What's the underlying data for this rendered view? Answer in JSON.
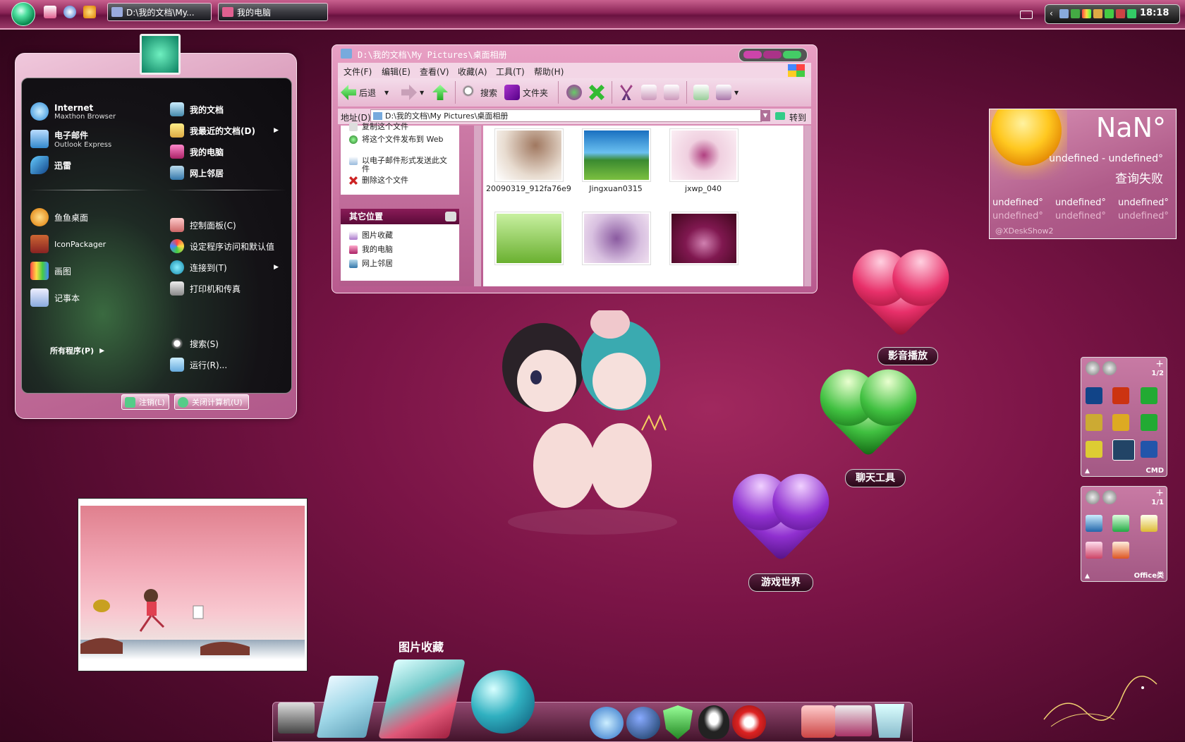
{
  "taskbar": {
    "tasks": [
      {
        "label": "D:\\我的文档\\My..."
      },
      {
        "label": "我的电脑"
      }
    ],
    "clock": "18:18"
  },
  "start_menu": {
    "pinned": [
      {
        "title": "Internet",
        "subtitle": "Maxthon Browser",
        "icon": "maxthon-browser-icon"
      },
      {
        "title": "电子邮件",
        "subtitle": "Outlook Express",
        "icon": "outlook-express-icon"
      },
      {
        "title": "迅雷",
        "subtitle": "",
        "icon": "xunlei-icon"
      }
    ],
    "recent": [
      {
        "title": "鱼鱼桌面",
        "icon": "fish-desktop-icon"
      },
      {
        "title": "IconPackager",
        "icon": "iconpackager-icon"
      },
      {
        "title": "画图",
        "icon": "paint-icon"
      },
      {
        "title": "记事本",
        "icon": "notepad-icon"
      }
    ],
    "all_programs": "所有程序(P)",
    "right_items": [
      {
        "title": "我的文档",
        "bold": true,
        "arrow": false,
        "icon": "my-documents-icon"
      },
      {
        "title": "我最近的文档(D)",
        "bold": true,
        "arrow": true,
        "icon": "recent-documents-icon"
      },
      {
        "title": "我的电脑",
        "bold": true,
        "arrow": false,
        "icon": "my-computer-icon"
      },
      {
        "title": "网上邻居",
        "bold": true,
        "arrow": false,
        "icon": "network-places-icon"
      },
      {
        "title": "控制面板(C)",
        "bold": false,
        "arrow": false,
        "icon": "control-panel-icon"
      },
      {
        "title": "设定程序访问和默认值",
        "bold": false,
        "arrow": false,
        "icon": "program-defaults-icon"
      },
      {
        "title": "连接到(T)",
        "bold": false,
        "arrow": true,
        "icon": "connect-to-icon"
      },
      {
        "title": "打印机和传真",
        "bold": false,
        "arrow": false,
        "icon": "printer-icon"
      },
      {
        "title": "搜索(S)",
        "bold": false,
        "arrow": false,
        "icon": "search-icon"
      },
      {
        "title": "运行(R)...",
        "bold": false,
        "arrow": false,
        "icon": "run-icon"
      }
    ],
    "logoff": "注销(L)",
    "shutdown": "关闭计算机(U)"
  },
  "explorer": {
    "title": "D:\\我的文档\\My Pictures\\桌面相册",
    "menu": [
      "文件(F)",
      "编辑(E)",
      "查看(V)",
      "收藏(A)",
      "工具(T)",
      "帮助(H)"
    ],
    "toolbar": {
      "back": "后退",
      "search": "搜索",
      "folders": "文件夹"
    },
    "address_label": "地址(D)",
    "address": "D:\\我的文档\\My Pictures\\桌面相册",
    "go": "转到",
    "tasks": [
      "复制这个文件",
      "将这个文件发布到 Web",
      "以电子邮件形式发送此文件",
      "删除这个文件"
    ],
    "other_places_title": "其它位置",
    "other_places": [
      "图片收藏",
      "我的电脑",
      "网上邻居"
    ],
    "files": [
      {
        "name": "20090319_912fa76e9..."
      },
      {
        "name": "Jingxuan0315"
      },
      {
        "name": "jxwp_040"
      },
      {
        "name": ""
      },
      {
        "name": ""
      },
      {
        "name": ""
      }
    ]
  },
  "weather": {
    "temp": "NaN°",
    "range": "undefined - undefined°",
    "status": "查询失败",
    "forecast": [
      {
        "high": "undefined°",
        "low": "undefined°"
      },
      {
        "high": "undefined°",
        "low": "undefined°"
      },
      {
        "high": "undefined°",
        "low": "undefined°"
      }
    ],
    "credit": "@XDeskShow2"
  },
  "hearts": [
    {
      "label": "影音播放",
      "color": "#e8306a"
    },
    {
      "label": "聊天工具",
      "color": "#40c040"
    },
    {
      "label": "游戏世界",
      "color": "#9030d0"
    }
  ],
  "side_docks": [
    {
      "page": "1/2",
      "footer": "CMD"
    },
    {
      "page": "1/1",
      "footer": "Office类"
    }
  ],
  "dock": {
    "hover_label": "图片收藏"
  }
}
